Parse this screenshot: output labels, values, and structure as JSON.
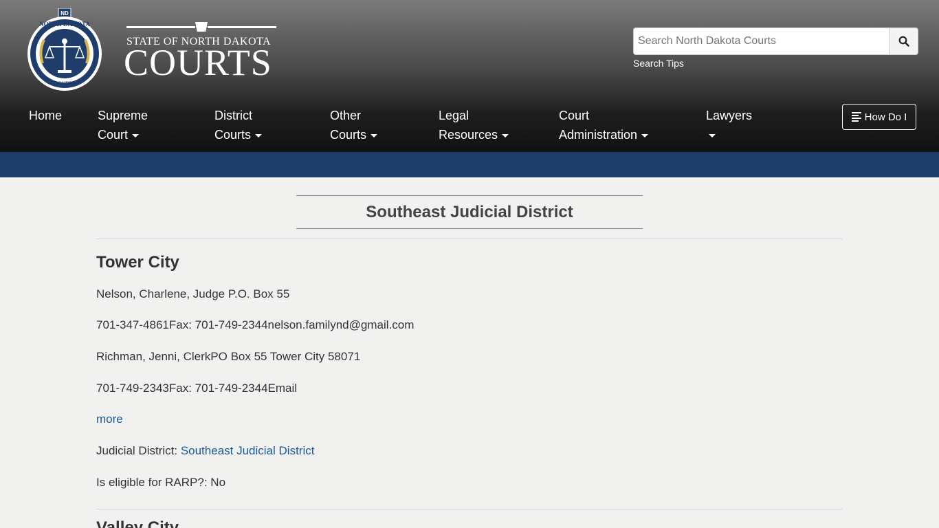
{
  "header": {
    "seal_text_top": "NORTH DAKOTA",
    "seal_text_bottom": "COURTS",
    "seal_badge": "ND",
    "wordmark_line1": "STATE OF NORTH DAKOTA",
    "wordmark_line2": "COURTS",
    "search_placeholder": "Search North Dakota Courts",
    "search_tips": "Search Tips"
  },
  "nav": {
    "items": [
      {
        "line1": "Home",
        "line2": ""
      },
      {
        "line1": "Supreme",
        "line2": "Court"
      },
      {
        "line1": "District",
        "line2": "Courts"
      },
      {
        "line1": "Other",
        "line2": "Courts"
      },
      {
        "line1": "Legal",
        "line2": "Resources"
      },
      {
        "line1": "Court",
        "line2": "Administration"
      },
      {
        "line1": "Lawyers",
        "line2": ""
      }
    ],
    "how_do_i": "How Do I"
  },
  "main": {
    "page_title": "Southeast Judicial District",
    "entry": {
      "heading": "Tower City",
      "judge_line": "Nelson, Charlene, Judge P.O. Box 55",
      "judge_contact": "701-347-4861Fax: 701-749-2344nelson.familynd@gmail.com",
      "clerk_line": "Richman, Jenni, ClerkPO Box 55 Tower City  58071",
      "clerk_contact": "701-749-2343Fax: 701-749-2344Email",
      "more_link": "more",
      "district_label": "Judicial District: ",
      "district_link": "Southeast Judicial District",
      "rarp": "Is eligible for RARP?: No"
    },
    "next_heading": "Valley City"
  },
  "colors": {
    "accent_blue": "#1f3d6b",
    "link": "#1a5a96"
  }
}
